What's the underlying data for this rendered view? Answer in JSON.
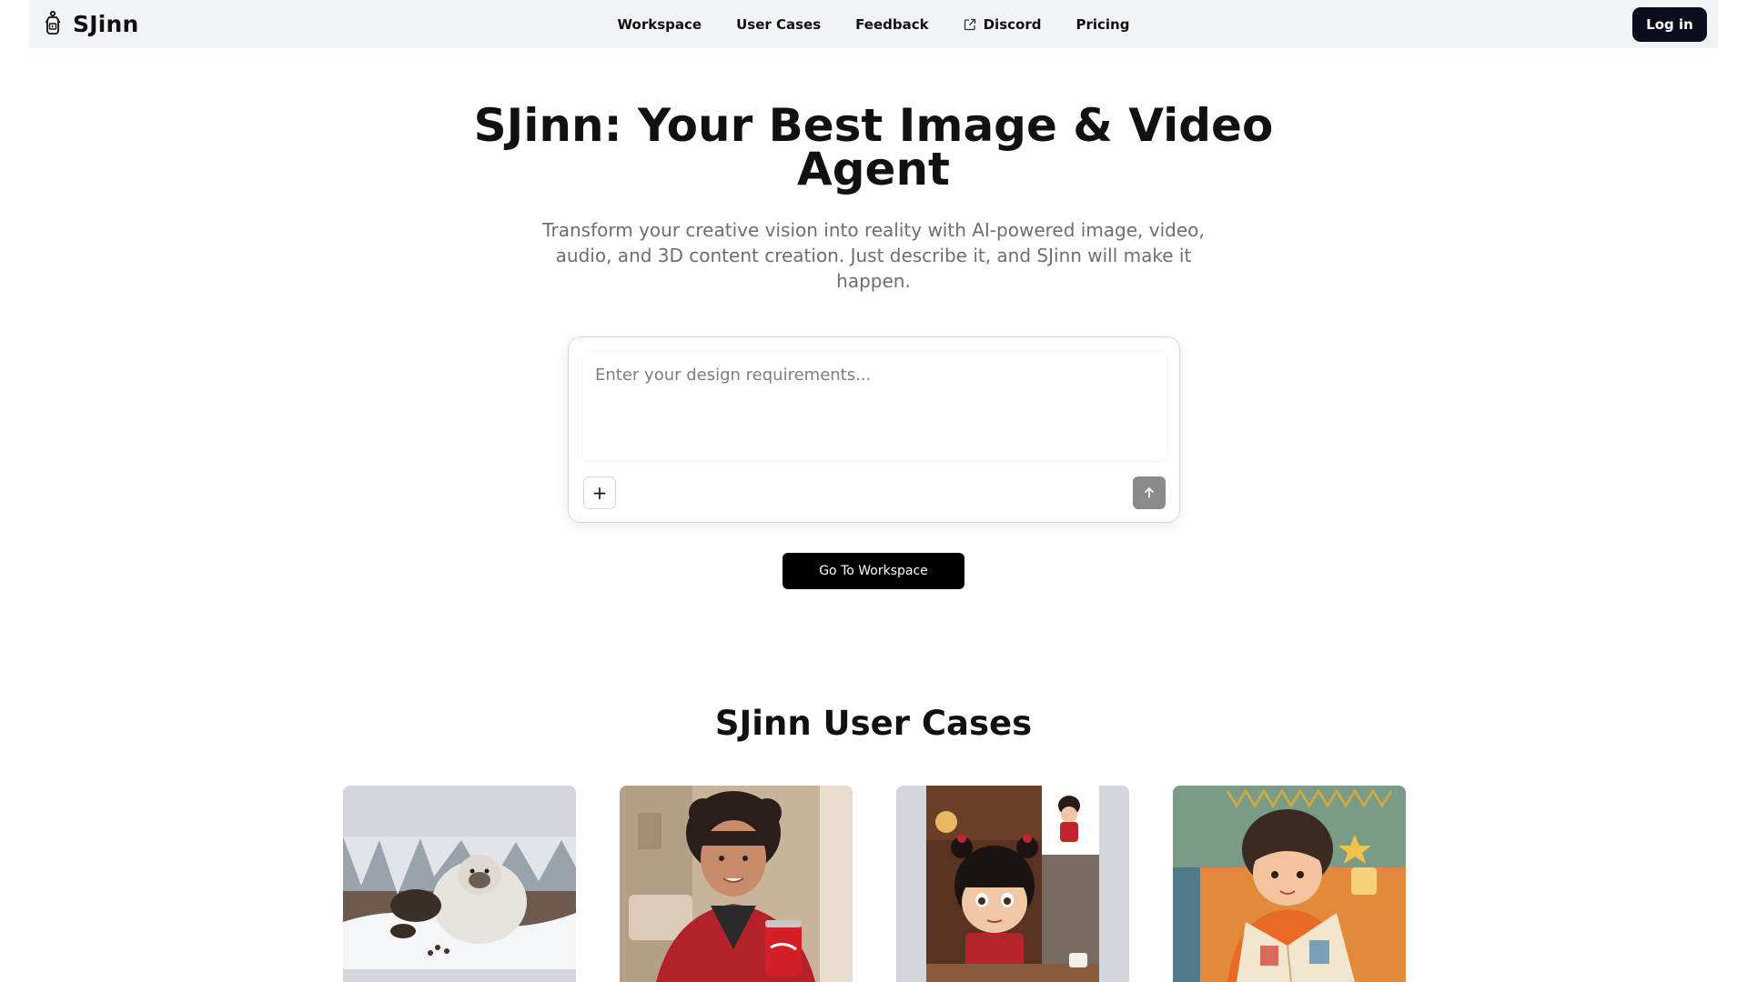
{
  "header": {
    "brand": "SJinn",
    "nav": [
      {
        "label": "Workspace"
      },
      {
        "label": "User Cases"
      },
      {
        "label": "Feedback"
      },
      {
        "label": "Discord",
        "icon": "external-link-icon"
      },
      {
        "label": "Pricing"
      }
    ],
    "login_label": "Log in"
  },
  "hero": {
    "title": "SJinn: Your Best Image & Video Agent",
    "subtitle": "Transform your creative vision into reality with AI-powered image, video, audio, and 3D content creation. Just describe it, and SJinn will make it happen."
  },
  "prompt": {
    "placeholder": "Enter your design requirements...",
    "value": "",
    "add_label": "+",
    "send_icon": "arrow-up-icon"
  },
  "goto_label": "Go To Workspace",
  "user_cases": {
    "title": "SJinn User Cases",
    "cases": [
      {
        "name": "yeti-snow-scene"
      },
      {
        "name": "woman-with-cola"
      },
      {
        "name": "animated-girl-cafe"
      },
      {
        "name": "boy-reading-book"
      }
    ]
  },
  "colors": {
    "header_bg": "#f1f3f7",
    "login_bg": "#0b0d1c",
    "send_bg": "#8a8a8a",
    "subtitle": "#6b6e76"
  }
}
